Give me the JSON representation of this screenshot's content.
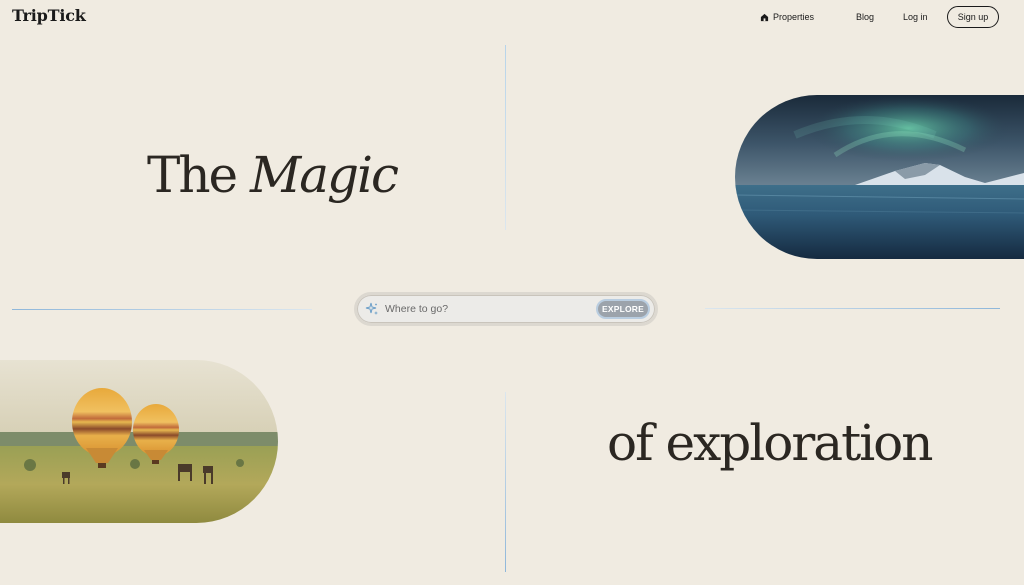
{
  "brand": {
    "name": "TripTick"
  },
  "nav": {
    "properties": "Properties",
    "blog": "Blog",
    "login": "Log in",
    "signup": "Sign up"
  },
  "hero": {
    "top_plain": "The ",
    "top_italic": "Magic",
    "bottom": "of exploration"
  },
  "search": {
    "placeholder": "Where to go?",
    "button": "EXPLORE"
  },
  "colors": {
    "background": "#f0ebe1",
    "text": "#2b2722",
    "accent_line": "#8fb7da",
    "explore_button": "#9ca3ab"
  },
  "icons": {
    "properties": "home-icon",
    "search": "sparkle-icon"
  }
}
